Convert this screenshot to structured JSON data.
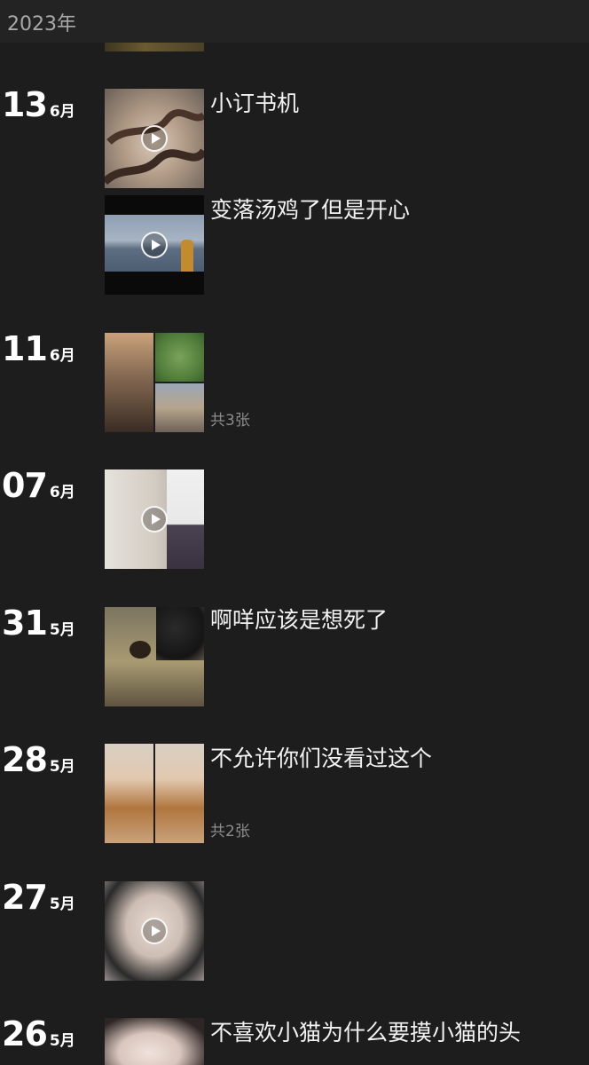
{
  "year_header": {
    "label": "2023年"
  },
  "entries": [
    {
      "day": "13",
      "month": "6月",
      "posts": [
        {
          "caption": "小订书机",
          "media": "video",
          "thumbnail_icon": "snake-video-thumbnail"
        },
        {
          "caption": "变落汤鸡了但是开心",
          "media": "video",
          "thumbnail_icon": "lake-video-thumbnail"
        }
      ]
    },
    {
      "day": "11",
      "month": "6月",
      "posts": [
        {
          "caption": "",
          "media": "photo-grid",
          "count_label": "共3张",
          "thumbnail_icon": "three-photo-grid"
        }
      ]
    },
    {
      "day": "07",
      "month": "6月",
      "posts": [
        {
          "caption": "",
          "media": "video",
          "thumbnail_icon": "room-video-thumbnail"
        }
      ]
    },
    {
      "day": "31",
      "month": "5月",
      "posts": [
        {
          "caption": "啊咩应该是想死了",
          "media": "photo",
          "thumbnail_icon": "spider-tank-photo"
        }
      ]
    },
    {
      "day": "28",
      "month": "5月",
      "posts": [
        {
          "caption": "不允许你们没看过这个",
          "media": "photo-grid",
          "count_label": "共2张",
          "thumbnail_icon": "two-photo-grid"
        }
      ]
    },
    {
      "day": "27",
      "month": "5月",
      "posts": [
        {
          "caption": "",
          "media": "video",
          "thumbnail_icon": "portrait-video-thumbnail"
        }
      ]
    },
    {
      "day": "26",
      "month": "5月",
      "posts": [
        {
          "caption": "不喜欢小猫为什么要摸小猫的头",
          "media": "photo",
          "thumbnail_icon": "portrait-photo"
        }
      ]
    }
  ]
}
